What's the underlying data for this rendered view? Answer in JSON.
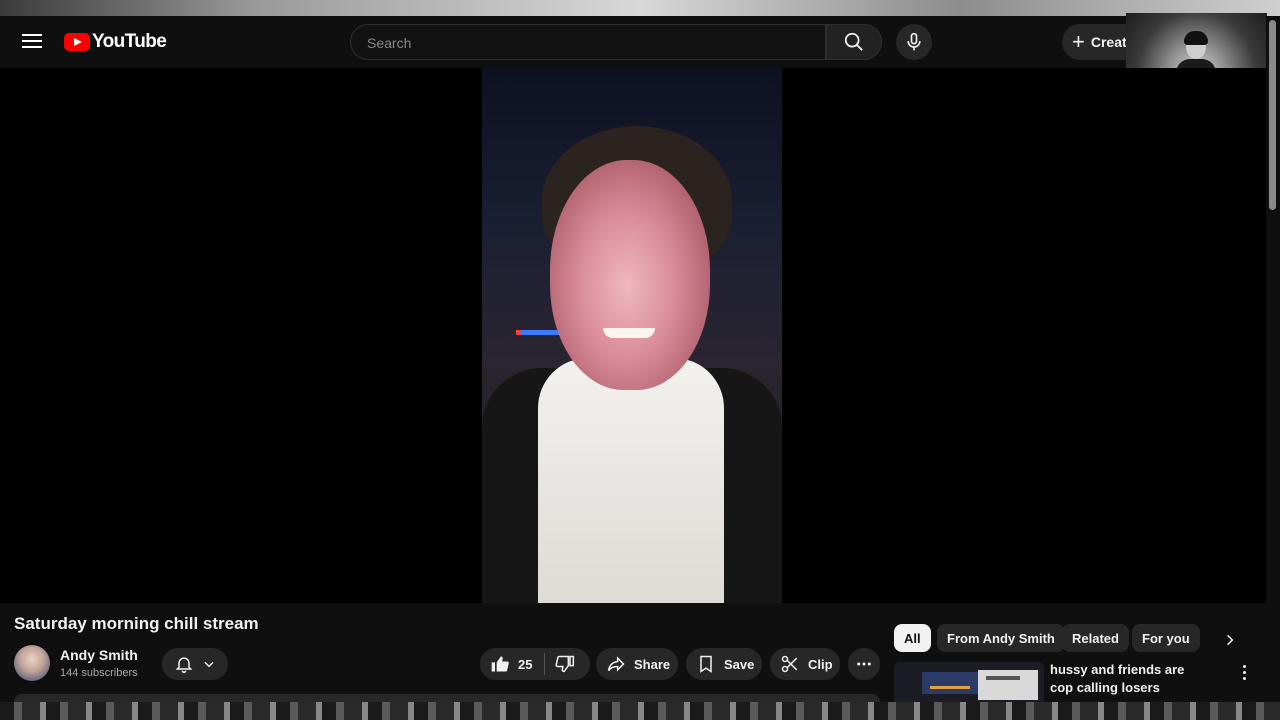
{
  "masthead": {
    "logo_text": "YouTube",
    "search_placeholder": "Search",
    "create_label": "Creat"
  },
  "video": {
    "title": "Saturday morning chill stream"
  },
  "owner": {
    "channel_name": "Andy Smith",
    "subscribers": "144 subscribers"
  },
  "actions": {
    "like_count": "25",
    "share_label": "Share",
    "save_label": "Save",
    "clip_label": "Clip"
  },
  "chips": [
    "All",
    "From Andy Smith",
    "Related",
    "For you"
  ],
  "related": [
    {
      "title": "hussy and friends are cop calling losers"
    }
  ],
  "colors": {
    "background": "#0f0f0f",
    "brand_red": "#ff0000",
    "pill_bg": "#272727",
    "text_primary": "#f1f1f1",
    "text_secondary": "#aaaaaa"
  }
}
